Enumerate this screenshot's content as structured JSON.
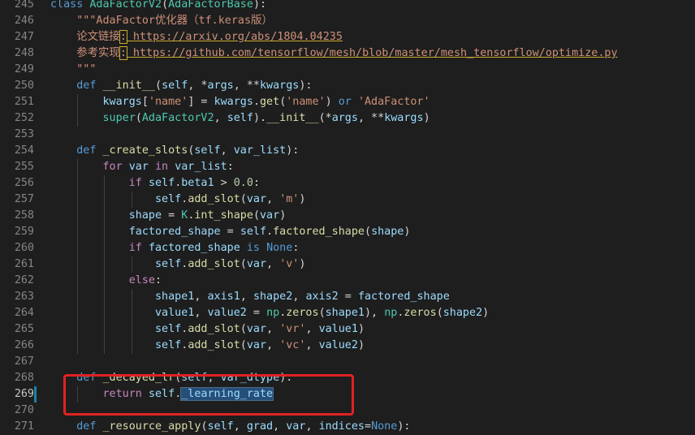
{
  "colors": {
    "background": "#1e1e1e",
    "keyword": "#569cd6",
    "control": "#c586c0",
    "class_name": "#4ec9b0",
    "function": "#dcdcaa",
    "variable": "#9cdcfe",
    "string": "#ce9178",
    "number": "#b5cea8",
    "default": "#d4d4d4",
    "line_number": "#858585",
    "annotation_box": "#e02222"
  },
  "current_line": 269,
  "lines": [
    {
      "n": "245",
      "indent": 0,
      "tokens": [
        [
          "class",
          "keyword"
        ],
        [
          " ",
          ""
        ],
        [
          "AdaFactorV2",
          "class_name"
        ],
        [
          "(",
          ""
        ],
        [
          "AdaFactorBase",
          "class_name"
        ],
        [
          "):",
          ""
        ]
      ]
    },
    {
      "n": "246",
      "indent": 1,
      "tokens": [
        [
          "\"\"\"AdaFactor优化器（tf.keras版）",
          "string"
        ]
      ]
    },
    {
      "n": "247",
      "indent": 1,
      "tokens": [
        [
          "论文链接",
          "string"
        ],
        [
          ":",
          "string colon"
        ],
        [
          " https://arxiv.org/abs/1804.04235",
          "string link"
        ]
      ]
    },
    {
      "n": "248",
      "indent": 1,
      "tokens": [
        [
          "参考实现",
          "string"
        ],
        [
          ":",
          "string colon"
        ],
        [
          " https://github.com/tensorflow/mesh/blob/master/mesh_tensorflow/optimize.py",
          "string link"
        ]
      ]
    },
    {
      "n": "249",
      "indent": 1,
      "tokens": [
        [
          "\"\"\"",
          "string"
        ]
      ]
    },
    {
      "n": "250",
      "indent": 1,
      "tokens": [
        [
          "def",
          "keyword"
        ],
        [
          " ",
          ""
        ],
        [
          "__init__",
          "function"
        ],
        [
          "(",
          ""
        ],
        [
          "self",
          "variable"
        ],
        [
          ", *",
          ""
        ],
        [
          "args",
          "variable"
        ],
        [
          ", **",
          ""
        ],
        [
          "kwargs",
          "variable"
        ],
        [
          "):",
          ""
        ]
      ]
    },
    {
      "n": "251",
      "indent": 2,
      "tokens": [
        [
          "kwargs",
          "variable"
        ],
        [
          "[",
          ""
        ],
        [
          "'name'",
          "string"
        ],
        [
          "] = ",
          ""
        ],
        [
          "kwargs",
          "variable"
        ],
        [
          ".",
          ""
        ],
        [
          "get",
          "function"
        ],
        [
          "(",
          ""
        ],
        [
          "'name'",
          "string"
        ],
        [
          ") ",
          ""
        ],
        [
          "or",
          "keyword"
        ],
        [
          " ",
          ""
        ],
        [
          "'AdaFactor'",
          "string"
        ]
      ]
    },
    {
      "n": "252",
      "indent": 2,
      "tokens": [
        [
          "super",
          "class_name"
        ],
        [
          "(",
          ""
        ],
        [
          "AdaFactorV2",
          "class_name"
        ],
        [
          ", ",
          ""
        ],
        [
          "self",
          "variable"
        ],
        [
          ").",
          ""
        ],
        [
          "__init__",
          "function"
        ],
        [
          "(*",
          ""
        ],
        [
          "args",
          "variable"
        ],
        [
          ", **",
          ""
        ],
        [
          "kwargs",
          "variable"
        ],
        [
          ")",
          ""
        ]
      ]
    },
    {
      "n": "253",
      "indent": 0,
      "tokens": []
    },
    {
      "n": "254",
      "indent": 1,
      "tokens": [
        [
          "def",
          "keyword"
        ],
        [
          " ",
          ""
        ],
        [
          "_create_slots",
          "function"
        ],
        [
          "(",
          ""
        ],
        [
          "self",
          "variable"
        ],
        [
          ", ",
          ""
        ],
        [
          "var_list",
          "variable"
        ],
        [
          "):",
          ""
        ]
      ]
    },
    {
      "n": "255",
      "indent": 2,
      "tokens": [
        [
          "for",
          "control"
        ],
        [
          " ",
          ""
        ],
        [
          "var",
          "variable"
        ],
        [
          " ",
          ""
        ],
        [
          "in",
          "control"
        ],
        [
          " ",
          ""
        ],
        [
          "var_list",
          "variable"
        ],
        [
          ":",
          ""
        ]
      ]
    },
    {
      "n": "256",
      "indent": 3,
      "tokens": [
        [
          "if",
          "control"
        ],
        [
          " ",
          ""
        ],
        [
          "self",
          "variable"
        ],
        [
          ".",
          ""
        ],
        [
          "beta1",
          "variable"
        ],
        [
          " > ",
          ""
        ],
        [
          "0.0",
          "number"
        ],
        [
          ":",
          ""
        ]
      ]
    },
    {
      "n": "257",
      "indent": 4,
      "tokens": [
        [
          "self",
          "variable"
        ],
        [
          ".",
          ""
        ],
        [
          "add_slot",
          "function"
        ],
        [
          "(",
          ""
        ],
        [
          "var",
          "variable"
        ],
        [
          ", ",
          ""
        ],
        [
          "'m'",
          "string"
        ],
        [
          ")",
          ""
        ]
      ]
    },
    {
      "n": "258",
      "indent": 3,
      "tokens": [
        [
          "shape",
          "variable"
        ],
        [
          " = ",
          ""
        ],
        [
          "K",
          "class_name"
        ],
        [
          ".",
          ""
        ],
        [
          "int_shape",
          "function"
        ],
        [
          "(",
          ""
        ],
        [
          "var",
          "variable"
        ],
        [
          ")",
          ""
        ]
      ]
    },
    {
      "n": "259",
      "indent": 3,
      "tokens": [
        [
          "factored_shape",
          "variable"
        ],
        [
          " = ",
          ""
        ],
        [
          "self",
          "variable"
        ],
        [
          ".",
          ""
        ],
        [
          "factored_shape",
          "function"
        ],
        [
          "(",
          ""
        ],
        [
          "shape",
          "variable"
        ],
        [
          ")",
          ""
        ]
      ]
    },
    {
      "n": "260",
      "indent": 3,
      "tokens": [
        [
          "if",
          "control"
        ],
        [
          " ",
          ""
        ],
        [
          "factored_shape",
          "variable"
        ],
        [
          " ",
          ""
        ],
        [
          "is",
          "keyword"
        ],
        [
          " ",
          ""
        ],
        [
          "None",
          "keyword"
        ],
        [
          ":",
          ""
        ]
      ]
    },
    {
      "n": "261",
      "indent": 4,
      "tokens": [
        [
          "self",
          "variable"
        ],
        [
          ".",
          ""
        ],
        [
          "add_slot",
          "function"
        ],
        [
          "(",
          ""
        ],
        [
          "var",
          "variable"
        ],
        [
          ", ",
          ""
        ],
        [
          "'v'",
          "string"
        ],
        [
          ")",
          ""
        ]
      ]
    },
    {
      "n": "262",
      "indent": 3,
      "tokens": [
        [
          "else",
          "control"
        ],
        [
          ":",
          ""
        ]
      ]
    },
    {
      "n": "263",
      "indent": 4,
      "tokens": [
        [
          "shape1",
          "variable"
        ],
        [
          ", ",
          ""
        ],
        [
          "axis1",
          "variable"
        ],
        [
          ", ",
          ""
        ],
        [
          "shape2",
          "variable"
        ],
        [
          ", ",
          ""
        ],
        [
          "axis2",
          "variable"
        ],
        [
          " = ",
          ""
        ],
        [
          "factored_shape",
          "variable"
        ]
      ]
    },
    {
      "n": "264",
      "indent": 4,
      "tokens": [
        [
          "value1",
          "variable"
        ],
        [
          ", ",
          ""
        ],
        [
          "value2",
          "variable"
        ],
        [
          " = ",
          ""
        ],
        [
          "np",
          "class_name"
        ],
        [
          ".",
          ""
        ],
        [
          "zeros",
          "function"
        ],
        [
          "(",
          ""
        ],
        [
          "shape1",
          "variable"
        ],
        [
          "), ",
          ""
        ],
        [
          "np",
          "class_name"
        ],
        [
          ".",
          ""
        ],
        [
          "zeros",
          "function"
        ],
        [
          "(",
          ""
        ],
        [
          "shape2",
          "variable"
        ],
        [
          ")",
          ""
        ]
      ]
    },
    {
      "n": "265",
      "indent": 4,
      "tokens": [
        [
          "self",
          "variable"
        ],
        [
          ".",
          ""
        ],
        [
          "add_slot",
          "function"
        ],
        [
          "(",
          ""
        ],
        [
          "var",
          "variable"
        ],
        [
          ", ",
          ""
        ],
        [
          "'vr'",
          "string"
        ],
        [
          ", ",
          ""
        ],
        [
          "value1",
          "variable"
        ],
        [
          ")",
          ""
        ]
      ]
    },
    {
      "n": "266",
      "indent": 4,
      "tokens": [
        [
          "self",
          "variable"
        ],
        [
          ".",
          ""
        ],
        [
          "add_slot",
          "function"
        ],
        [
          "(",
          ""
        ],
        [
          "var",
          "variable"
        ],
        [
          ", ",
          ""
        ],
        [
          "'vc'",
          "string"
        ],
        [
          ", ",
          ""
        ],
        [
          "value2",
          "variable"
        ],
        [
          ")",
          ""
        ]
      ]
    },
    {
      "n": "267",
      "indent": 0,
      "tokens": []
    },
    {
      "n": "268",
      "indent": 1,
      "tokens": [
        [
          "def",
          "keyword"
        ],
        [
          " ",
          ""
        ],
        [
          "_decayed_lr",
          "function"
        ],
        [
          "(",
          ""
        ],
        [
          "self",
          "variable"
        ],
        [
          ", ",
          ""
        ],
        [
          "var_dtype",
          "variable"
        ],
        [
          "):",
          ""
        ]
      ]
    },
    {
      "n": "269",
      "indent": 2,
      "tokens": [
        [
          "return",
          "control"
        ],
        [
          " ",
          ""
        ],
        [
          "self",
          "variable"
        ],
        [
          ".",
          ""
        ],
        [
          "_learning_rate",
          "variable sel"
        ]
      ]
    },
    {
      "n": "270",
      "indent": 0,
      "tokens": []
    },
    {
      "n": "271",
      "indent": 1,
      "tokens": [
        [
          "def",
          "keyword"
        ],
        [
          " ",
          ""
        ],
        [
          "_resource_apply",
          "function"
        ],
        [
          "(",
          ""
        ],
        [
          "self",
          "variable"
        ],
        [
          ", ",
          ""
        ],
        [
          "grad",
          "variable"
        ],
        [
          ", ",
          ""
        ],
        [
          "var",
          "variable"
        ],
        [
          ", ",
          ""
        ],
        [
          "indices",
          "variable"
        ],
        [
          "=",
          ""
        ],
        [
          "None",
          "keyword"
        ],
        [
          "):",
          ""
        ]
      ]
    }
  ]
}
